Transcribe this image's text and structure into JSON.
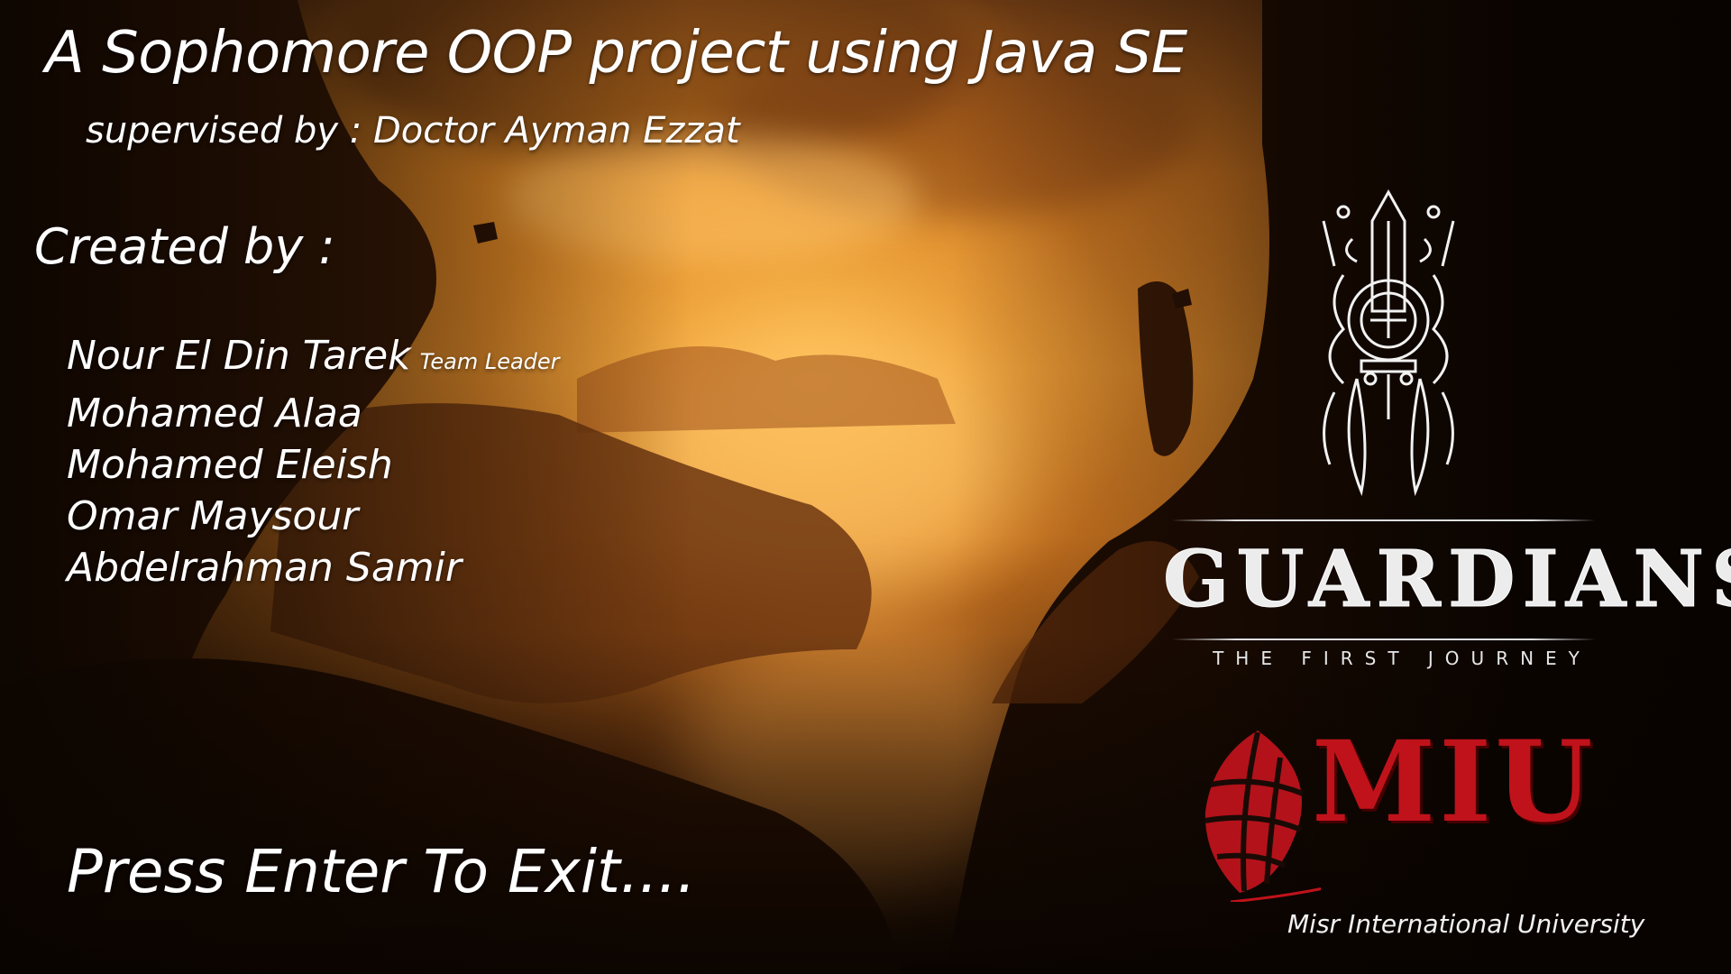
{
  "credits": {
    "title": "A Sophomore OOP project using Java SE",
    "supervisor": "supervised by : Doctor Ayman Ezzat",
    "created_by": "Created by :",
    "members": [
      {
        "name": "Nour El Din Tarek",
        "role": "Team Leader"
      },
      {
        "name": "Mohamed Alaa",
        "role": ""
      },
      {
        "name": "Mohamed Eleish",
        "role": ""
      },
      {
        "name": "Omar Maysour",
        "role": ""
      },
      {
        "name": "Abdelrahman Samir",
        "role": ""
      }
    ],
    "exit_prompt": "Press Enter To Exit...."
  },
  "game_logo": {
    "title": "GUARDIANS",
    "subtitle": "THE FIRST JOURNEY",
    "emblem_icon": "guardians-emblem-icon"
  },
  "university_logo": {
    "letters": "MIU",
    "name": "Misr International University",
    "globe_icon": "globe-icon",
    "brand_color": "#c0121a"
  },
  "colors": {
    "sky": "#e08b2b",
    "shadow": "#1a0c04",
    "text": "#ffffff"
  }
}
